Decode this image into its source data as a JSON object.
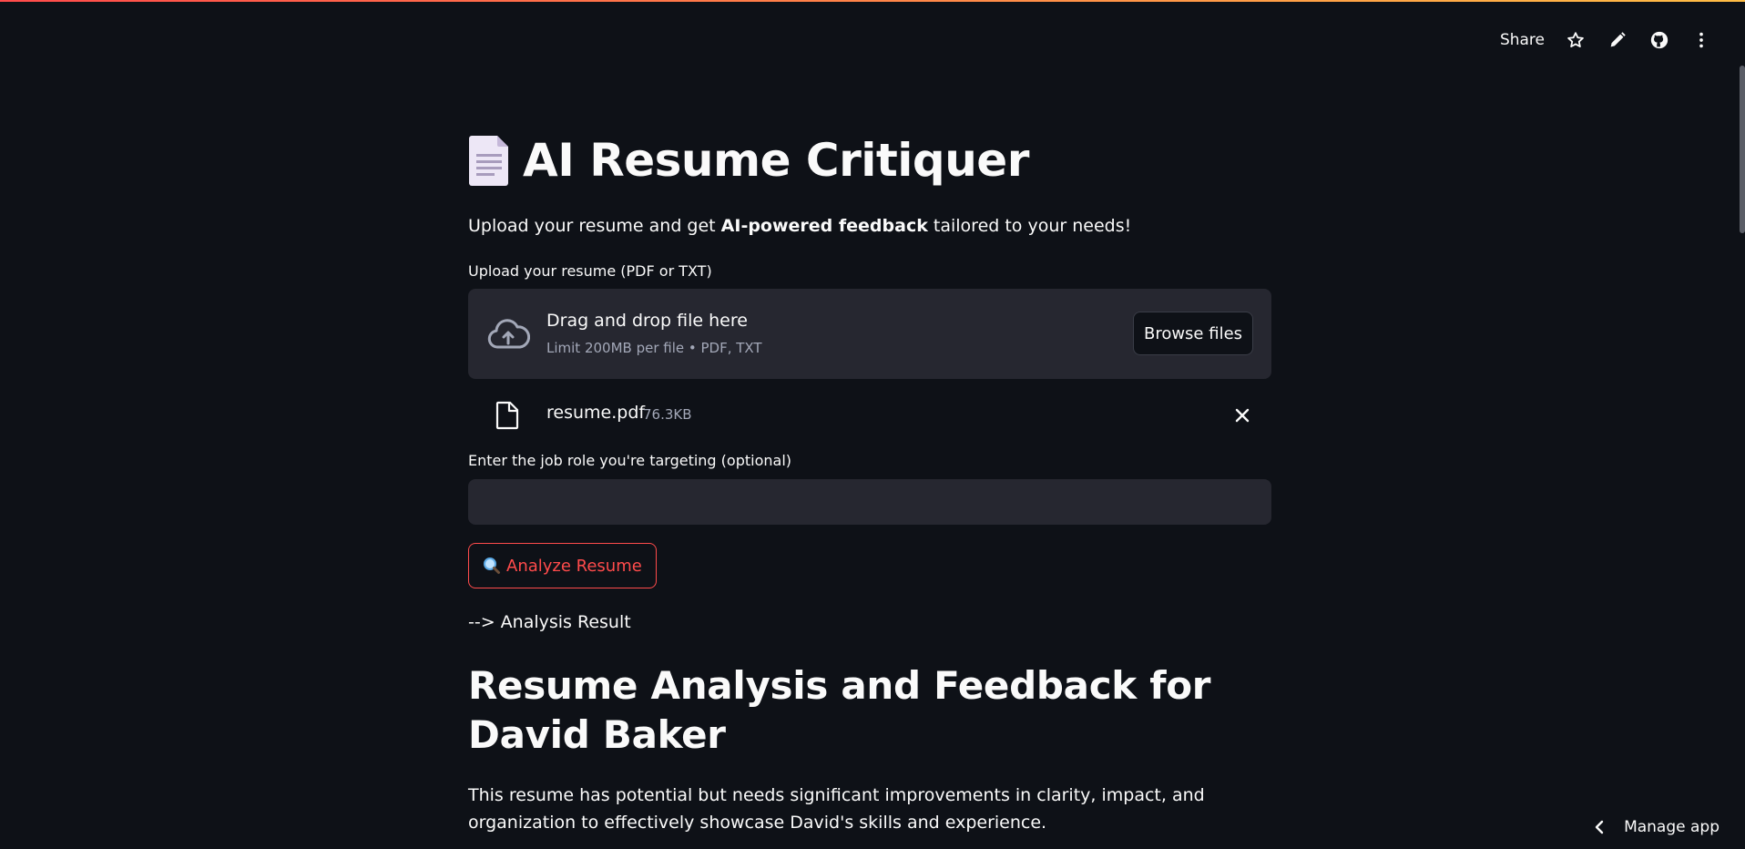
{
  "toolbar": {
    "share_label": "Share",
    "icons": [
      "star-icon",
      "pencil-icon",
      "github-icon",
      "kebab-menu-icon"
    ]
  },
  "header": {
    "emoji": "page-facing-up",
    "title": "AI Resume Critiquer",
    "subtitle_pre": "Upload your resume and get ",
    "subtitle_bold": "AI-powered feedback",
    "subtitle_post": " tailored to your needs!"
  },
  "uploader": {
    "label": "Upload your resume (PDF or TXT)",
    "drop_title": "Drag and drop file here",
    "drop_sub": "Limit 200MB per file • PDF, TXT",
    "browse_label": "Browse files",
    "file": {
      "name": "resume.pdf",
      "size": "76.3KB"
    }
  },
  "job_role": {
    "label": "Enter the job role you're targeting (optional)",
    "value": "",
    "placeholder": ""
  },
  "analyze": {
    "label": "Analyze Resume"
  },
  "result": {
    "label": "--> Analysis Result",
    "heading": "Resume Analysis and Feedback for David Baker",
    "paragraph": "This resume has potential but needs significant improvements in clarity, impact, and organization to effectively showcase David's skills and experience."
  },
  "footer": {
    "manage_label": "Manage app"
  },
  "colors": {
    "background": "#0e1117",
    "surface": "#262730",
    "accent": "#ff4b4b",
    "muted_text": "#a3a8b8"
  }
}
